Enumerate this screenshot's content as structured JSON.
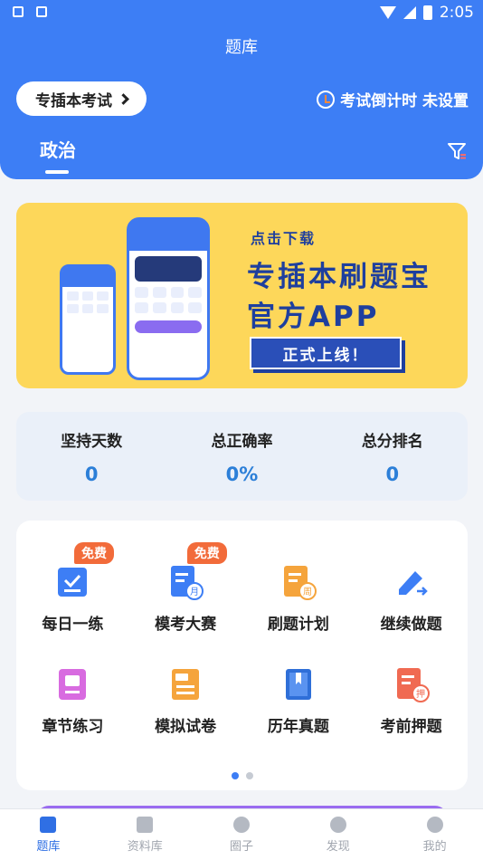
{
  "status_bar": {
    "time": "2:05"
  },
  "header": {
    "title": "题库",
    "exam_selector": "专插本考试",
    "countdown": "考试倒计时 未设置",
    "subject_tab": "政治"
  },
  "banner": {
    "download_text": "点击下载",
    "line1": "专插本刷题宝",
    "line2": "官方APP",
    "badge": "正式上线！"
  },
  "stats": [
    {
      "label": "坚持天数",
      "value": "0"
    },
    {
      "label": "总正确率",
      "value": "0%"
    },
    {
      "label": "总分排名",
      "value": "0"
    }
  ],
  "functions": [
    {
      "label": "每日一练",
      "badge": "免费",
      "icon": "daily-practice-icon",
      "color": "#3d7ef5"
    },
    {
      "label": "模考大赛",
      "badge": "免费",
      "icon": "mock-contest-icon",
      "color": "#3d7ef5"
    },
    {
      "label": "刷题计划",
      "badge": "",
      "icon": "study-plan-icon",
      "color": "#f5a43c"
    },
    {
      "label": "继续做题",
      "badge": "",
      "icon": "continue-icon",
      "color": "#3d7ef5"
    },
    {
      "label": "章节练习",
      "badge": "",
      "icon": "chapter-icon",
      "color": "#d86be0"
    },
    {
      "label": "模拟试卷",
      "badge": "",
      "icon": "mock-paper-icon",
      "color": "#f5a43c"
    },
    {
      "label": "历年真题",
      "badge": "",
      "icon": "past-papers-icon",
      "color": "#3d7ef5"
    },
    {
      "label": "考前押题",
      "badge": "",
      "icon": "predict-icon",
      "color": "#f06a52"
    }
  ],
  "bottom_nav": [
    {
      "label": "题库",
      "active": true
    },
    {
      "label": "资料库",
      "active": false
    },
    {
      "label": "圈子",
      "active": false
    },
    {
      "label": "发现",
      "active": false
    },
    {
      "label": "我的",
      "active": false
    }
  ]
}
